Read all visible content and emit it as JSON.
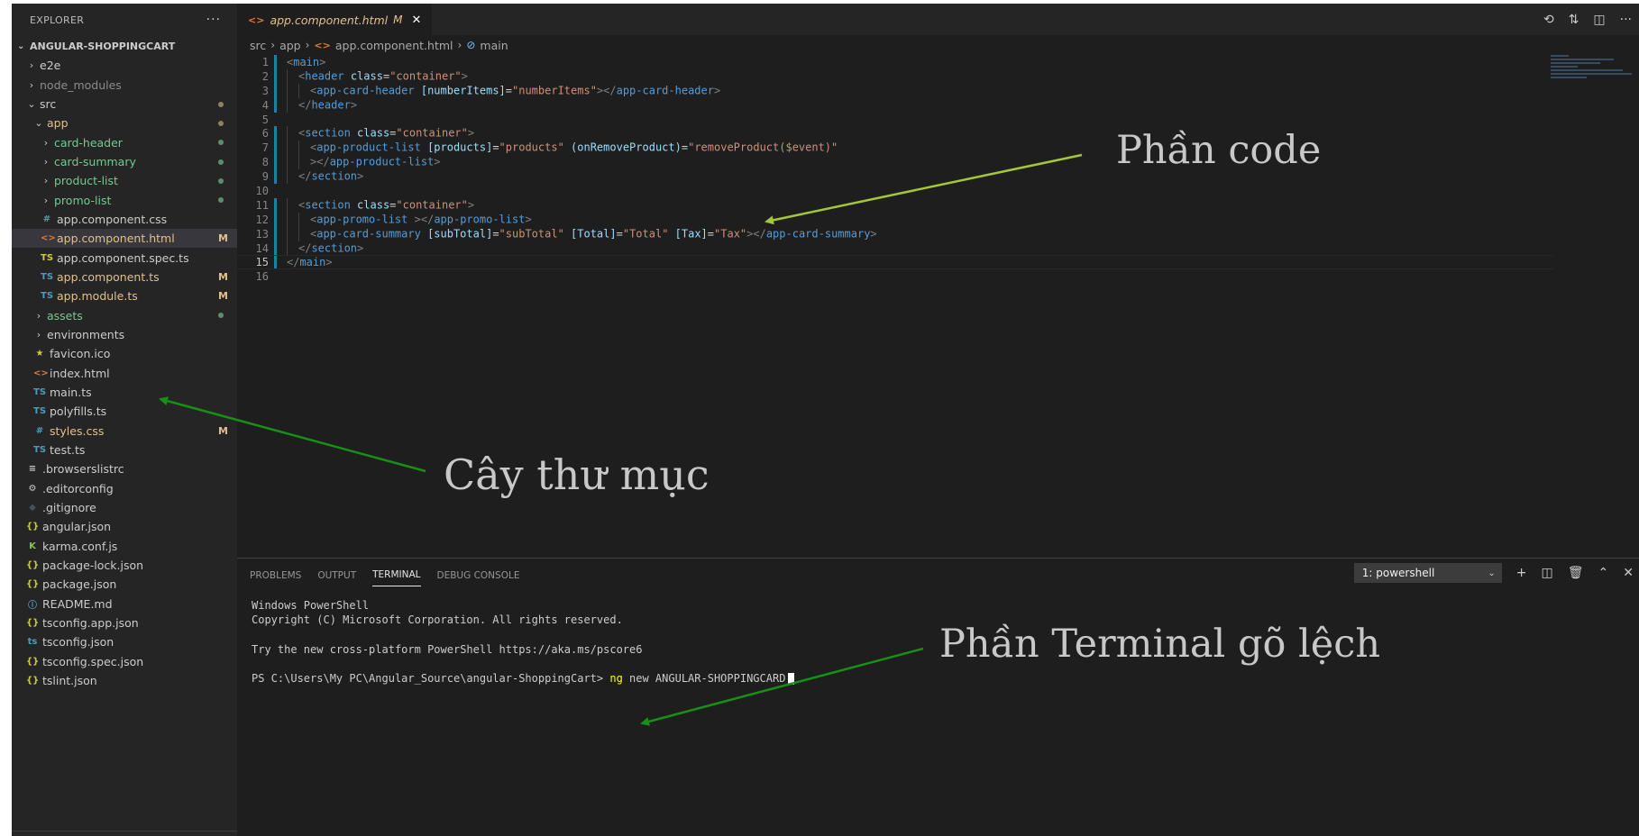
{
  "sidebar": {
    "title": "EXPLORER",
    "more": "···",
    "project": "ANGULAR-SHOPPINGCART",
    "items": [
      {
        "label": "e2e",
        "twist": "›",
        "icon": "",
        "indent": 16,
        "status": "",
        "badge": "",
        "dim": false
      },
      {
        "label": "node_modules",
        "twist": "›",
        "icon": "",
        "indent": 16,
        "status": "",
        "badge": "",
        "dim": true
      },
      {
        "label": "src",
        "twist": "⌄",
        "icon": "",
        "indent": 16,
        "status": "mod",
        "badge": "",
        "dim": false
      },
      {
        "label": "app",
        "twist": "⌄",
        "icon": "",
        "indent": 24,
        "status": "mod",
        "badge": "",
        "dim": false,
        "color": "mod"
      },
      {
        "label": "card-header",
        "twist": "›",
        "icon": "",
        "indent": 32,
        "status": "new",
        "badge": "",
        "color": "new"
      },
      {
        "label": "card-summary",
        "twist": "›",
        "icon": "",
        "indent": 32,
        "status": "new",
        "badge": "",
        "color": "new"
      },
      {
        "label": "product-list",
        "twist": "›",
        "icon": "",
        "indent": 32,
        "status": "new",
        "badge": "",
        "color": "new"
      },
      {
        "label": "promo-list",
        "twist": "›",
        "icon": "",
        "indent": 32,
        "status": "new",
        "badge": "",
        "color": "new"
      },
      {
        "label": "app.component.css",
        "twist": "",
        "icon": "#",
        "iconColor": "#519aba",
        "indent": 32,
        "status": "",
        "badge": ""
      },
      {
        "label": "app.component.html",
        "twist": "",
        "icon": "<>",
        "iconColor": "#e37933",
        "indent": 32,
        "status": "",
        "badge": "M",
        "color": "mod",
        "selected": true
      },
      {
        "label": "app.component.spec.ts",
        "twist": "",
        "icon": "TS",
        "iconColor": "#cbcb41",
        "indent": 32,
        "status": "",
        "badge": ""
      },
      {
        "label": "app.component.ts",
        "twist": "",
        "icon": "TS",
        "iconColor": "#519aba",
        "indent": 32,
        "status": "",
        "badge": "M",
        "color": "mod"
      },
      {
        "label": "app.module.ts",
        "twist": "",
        "icon": "TS",
        "iconColor": "#519aba",
        "indent": 32,
        "status": "",
        "badge": "M",
        "color": "mod"
      },
      {
        "label": "assets",
        "twist": "›",
        "icon": "",
        "indent": 24,
        "status": "new",
        "badge": "",
        "color": "new"
      },
      {
        "label": "environments",
        "twist": "›",
        "icon": "",
        "indent": 24,
        "status": "",
        "badge": ""
      },
      {
        "label": "favicon.ico",
        "twist": "",
        "icon": "★",
        "iconColor": "#cbcb41",
        "indent": 24,
        "status": "",
        "badge": ""
      },
      {
        "label": "index.html",
        "twist": "",
        "icon": "<>",
        "iconColor": "#e37933",
        "indent": 24,
        "status": "",
        "badge": ""
      },
      {
        "label": "main.ts",
        "twist": "",
        "icon": "TS",
        "iconColor": "#519aba",
        "indent": 24,
        "status": "",
        "badge": ""
      },
      {
        "label": "polyfills.ts",
        "twist": "",
        "icon": "TS",
        "iconColor": "#519aba",
        "indent": 24,
        "status": "",
        "badge": ""
      },
      {
        "label": "styles.css",
        "twist": "",
        "icon": "#",
        "iconColor": "#519aba",
        "indent": 24,
        "status": "",
        "badge": "M",
        "color": "mod"
      },
      {
        "label": "test.ts",
        "twist": "",
        "icon": "TS",
        "iconColor": "#519aba",
        "indent": 24,
        "status": "",
        "badge": ""
      },
      {
        "label": ".browserslistrc",
        "twist": "",
        "icon": "≡",
        "iconColor": "#cccccc",
        "indent": 16,
        "status": "",
        "badge": ""
      },
      {
        "label": ".editorconfig",
        "twist": "",
        "icon": "⚙",
        "iconColor": "#cccccc",
        "indent": 16,
        "status": "",
        "badge": ""
      },
      {
        "label": ".gitignore",
        "twist": "",
        "icon": "◆",
        "iconColor": "#41535b",
        "indent": 16,
        "status": "",
        "badge": ""
      },
      {
        "label": "angular.json",
        "twist": "",
        "icon": "{}",
        "iconColor": "#cbcb41",
        "indent": 16,
        "status": "",
        "badge": ""
      },
      {
        "label": "karma.conf.js",
        "twist": "",
        "icon": "K",
        "iconColor": "#8dc149",
        "indent": 16,
        "status": "",
        "badge": ""
      },
      {
        "label": "package-lock.json",
        "twist": "",
        "icon": "{}",
        "iconColor": "#cbcb41",
        "indent": 16,
        "status": "",
        "badge": ""
      },
      {
        "label": "package.json",
        "twist": "",
        "icon": "{}",
        "iconColor": "#cbcb41",
        "indent": 16,
        "status": "",
        "badge": ""
      },
      {
        "label": "README.md",
        "twist": "",
        "icon": "ⓘ",
        "iconColor": "#519aba",
        "indent": 16,
        "status": "",
        "badge": ""
      },
      {
        "label": "tsconfig.app.json",
        "twist": "",
        "icon": "{}",
        "iconColor": "#cbcb41",
        "indent": 16,
        "status": "",
        "badge": ""
      },
      {
        "label": "tsconfig.json",
        "twist": "",
        "icon": "ts",
        "iconColor": "#519aba",
        "indent": 16,
        "status": "",
        "badge": ""
      },
      {
        "label": "tsconfig.spec.json",
        "twist": "",
        "icon": "{}",
        "iconColor": "#cbcb41",
        "indent": 16,
        "status": "",
        "badge": ""
      },
      {
        "label": "tslint.json",
        "twist": "",
        "icon": "{}",
        "iconColor": "#cbcb41",
        "indent": 16,
        "status": "",
        "badge": ""
      }
    ]
  },
  "editor": {
    "tab": {
      "icon": "<>",
      "label": "app.component.html",
      "modified": "M",
      "close": "✕"
    },
    "breadcrumb": [
      "src",
      "app",
      "app.component.html",
      "main"
    ],
    "current_line": 15,
    "lines": [
      {
        "n": "1",
        "indent": 0,
        "mod": true,
        "tokens": [
          [
            "punc",
            "<"
          ],
          [
            "tag",
            "main"
          ],
          [
            "punc",
            ">"
          ]
        ]
      },
      {
        "n": "2",
        "indent": 1,
        "mod": true,
        "tokens": [
          [
            "punc",
            "<"
          ],
          [
            "tag",
            "header"
          ],
          [
            "text",
            " "
          ],
          [
            "attr",
            "class"
          ],
          [
            "text",
            "="
          ],
          [
            "str",
            "\"container\""
          ],
          [
            "punc",
            ">"
          ]
        ]
      },
      {
        "n": "3",
        "indent": 2,
        "mod": true,
        "tokens": [
          [
            "punc",
            "<"
          ],
          [
            "tag",
            "app-card-header"
          ],
          [
            "text",
            " "
          ],
          [
            "attr",
            "[numberItems]"
          ],
          [
            "text",
            "="
          ],
          [
            "str",
            "\"numberItems\""
          ],
          [
            "punc",
            "></"
          ],
          [
            "tag",
            "app-card-header"
          ],
          [
            "punc",
            ">"
          ]
        ]
      },
      {
        "n": "4",
        "indent": 1,
        "mod": true,
        "tokens": [
          [
            "punc",
            "</"
          ],
          [
            "tag",
            "header"
          ],
          [
            "punc",
            ">"
          ]
        ]
      },
      {
        "n": "5",
        "indent": 0,
        "mod": false,
        "tokens": []
      },
      {
        "n": "6",
        "indent": 1,
        "mod": true,
        "tokens": [
          [
            "punc",
            "<"
          ],
          [
            "tag",
            "section"
          ],
          [
            "text",
            " "
          ],
          [
            "attr",
            "class"
          ],
          [
            "text",
            "="
          ],
          [
            "str",
            "\"container\""
          ],
          [
            "punc",
            ">"
          ]
        ]
      },
      {
        "n": "7",
        "indent": 2,
        "mod": true,
        "tokens": [
          [
            "punc",
            "<"
          ],
          [
            "tag",
            "app-product-list"
          ],
          [
            "text",
            " "
          ],
          [
            "attr",
            "[products]"
          ],
          [
            "text",
            "="
          ],
          [
            "str",
            "\"products\""
          ],
          [
            "text",
            " "
          ],
          [
            "attr",
            "(onRemoveProduct)"
          ],
          [
            "text",
            "="
          ],
          [
            "str",
            "\"removeProduct($event)\""
          ]
        ]
      },
      {
        "n": "8",
        "indent": 2,
        "mod": true,
        "tokens": [
          [
            "punc",
            "></"
          ],
          [
            "tag",
            "app-product-list"
          ],
          [
            "punc",
            ">"
          ]
        ]
      },
      {
        "n": "9",
        "indent": 1,
        "mod": true,
        "tokens": [
          [
            "punc",
            "</"
          ],
          [
            "tag",
            "section"
          ],
          [
            "punc",
            ">"
          ]
        ]
      },
      {
        "n": "10",
        "indent": 0,
        "mod": false,
        "tokens": []
      },
      {
        "n": "11",
        "indent": 1,
        "mod": true,
        "tokens": [
          [
            "punc",
            "<"
          ],
          [
            "tag",
            "section"
          ],
          [
            "text",
            " "
          ],
          [
            "attr",
            "class"
          ],
          [
            "text",
            "="
          ],
          [
            "str",
            "\"container\""
          ],
          [
            "punc",
            ">"
          ]
        ]
      },
      {
        "n": "12",
        "indent": 2,
        "mod": true,
        "tokens": [
          [
            "punc",
            "<"
          ],
          [
            "tag",
            "app-promo-list"
          ],
          [
            "text",
            " "
          ],
          [
            "punc",
            "></"
          ],
          [
            "tag",
            "app-promo-list"
          ],
          [
            "punc",
            ">"
          ]
        ]
      },
      {
        "n": "13",
        "indent": 2,
        "mod": true,
        "tokens": [
          [
            "punc",
            "<"
          ],
          [
            "tag",
            "app-card-summary"
          ],
          [
            "text",
            " "
          ],
          [
            "attr",
            "[subTotal]"
          ],
          [
            "text",
            "="
          ],
          [
            "str",
            "\"subTotal\""
          ],
          [
            "text",
            " "
          ],
          [
            "attr",
            "[Total]"
          ],
          [
            "text",
            "="
          ],
          [
            "str",
            "\"Total\""
          ],
          [
            "text",
            " "
          ],
          [
            "attr",
            "[Tax]"
          ],
          [
            "text",
            "="
          ],
          [
            "str",
            "\"Tax\""
          ],
          [
            "punc",
            "></"
          ],
          [
            "tag",
            "app-card-summary"
          ],
          [
            "punc",
            ">"
          ]
        ]
      },
      {
        "n": "14",
        "indent": 1,
        "mod": true,
        "tokens": [
          [
            "punc",
            "</"
          ],
          [
            "tag",
            "section"
          ],
          [
            "punc",
            ">"
          ]
        ]
      },
      {
        "n": "15",
        "indent": 0,
        "mod": true,
        "tokens": [
          [
            "punc",
            "</"
          ],
          [
            "tag",
            "main"
          ],
          [
            "punc",
            ">"
          ]
        ]
      },
      {
        "n": "16",
        "indent": 0,
        "mod": false,
        "tokens": []
      }
    ]
  },
  "panel": {
    "tabs": [
      "PROBLEMS",
      "OUTPUT",
      "TERMINAL",
      "DEBUG CONSOLE"
    ],
    "active_tab": "TERMINAL",
    "terminal_select": "1: powershell",
    "terminal_lines": [
      "Windows PowerShell",
      "Copyright (C) Microsoft Corporation. All rights reserved.",
      "",
      "Try the new cross-platform PowerShell https://aka.ms/pscore6",
      ""
    ],
    "prompt": "PS C:\\Users\\My PC\\Angular_Source\\angular-ShoppingCart> ",
    "command": "ng",
    "command_args": " new ANGULAR-SHOPPINGCARD"
  },
  "annotations": {
    "code": "Phần code",
    "tree": "Cây thư mục",
    "terminal": "Phần Terminal gõ lệch"
  },
  "colors": {
    "arrow_code": "#a4c639",
    "arrow_green": "#169116"
  }
}
